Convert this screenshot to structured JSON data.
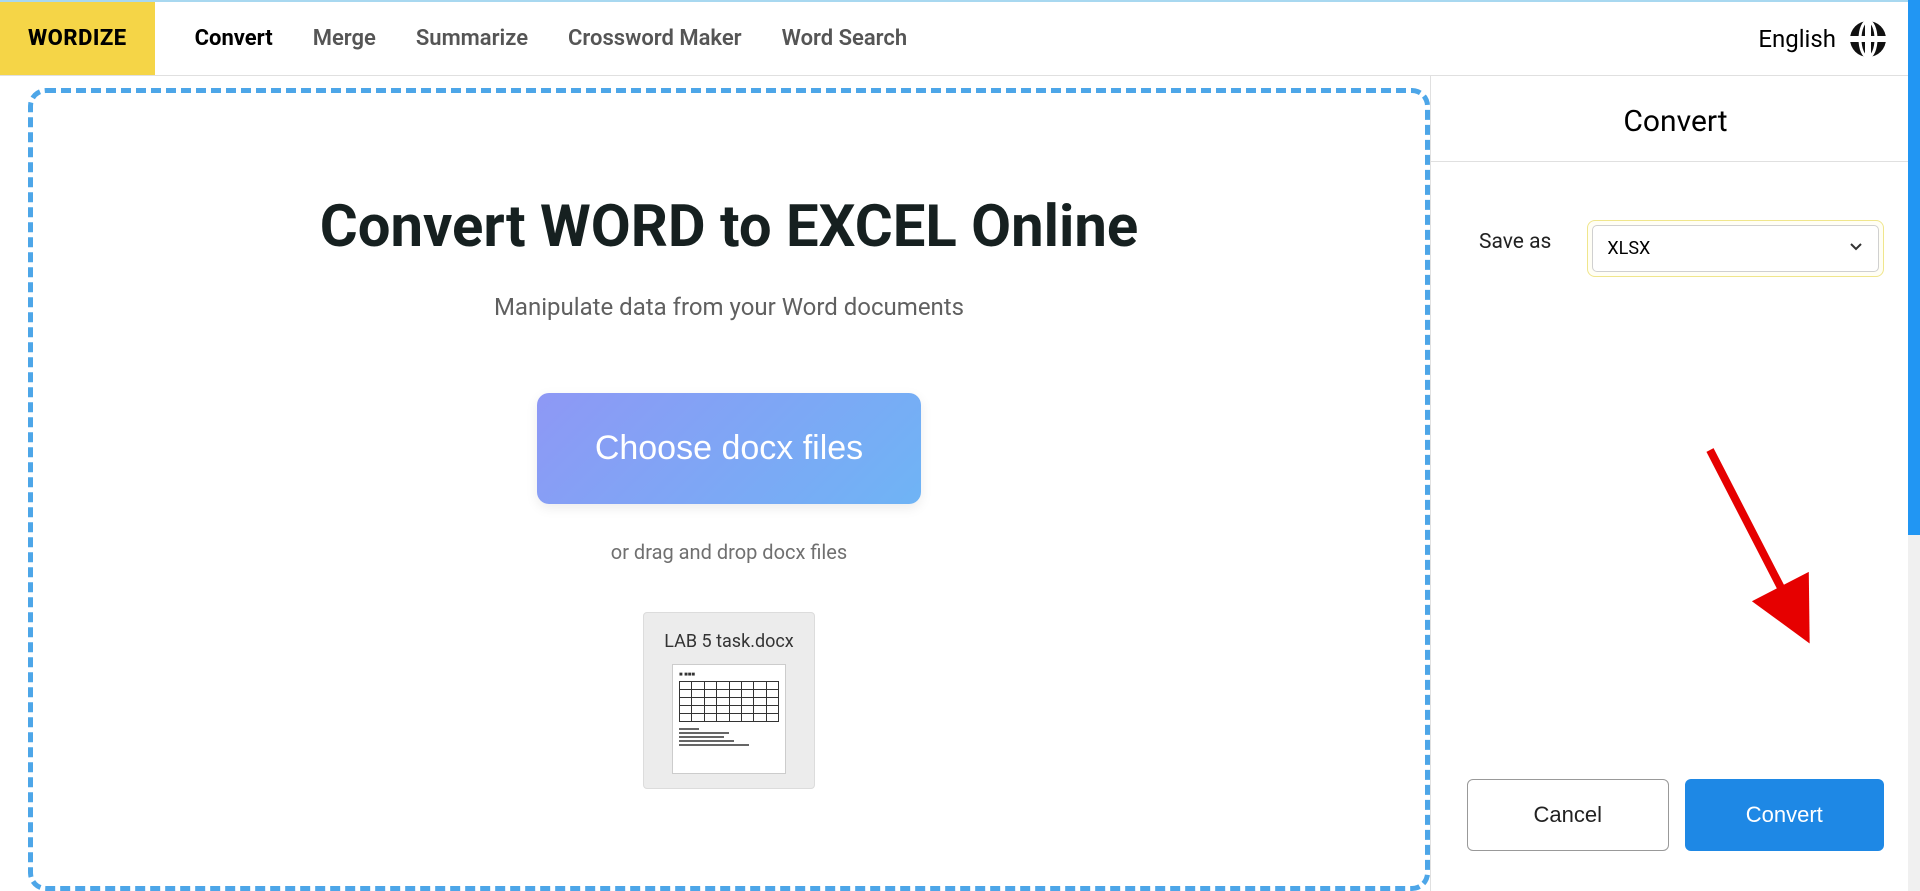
{
  "header": {
    "logo": "WORDIZE",
    "nav": [
      {
        "label": "Convert",
        "active": true
      },
      {
        "label": "Merge",
        "active": false
      },
      {
        "label": "Summarize",
        "active": false
      },
      {
        "label": "Crossword Maker",
        "active": false
      },
      {
        "label": "Word Search",
        "active": false
      }
    ],
    "language": "English"
  },
  "main": {
    "heading": "Convert WORD to EXCEL Online",
    "subheading": "Manipulate data from your Word documents",
    "choose_button": "Choose docx files",
    "drag_text": "or drag and drop docx files",
    "uploaded_file": {
      "name": "LAB 5 task.docx"
    }
  },
  "sidebar": {
    "title": "Convert",
    "save_as_label": "Save as",
    "format_selected": "XLSX",
    "cancel_label": "Cancel",
    "convert_label": "Convert"
  }
}
